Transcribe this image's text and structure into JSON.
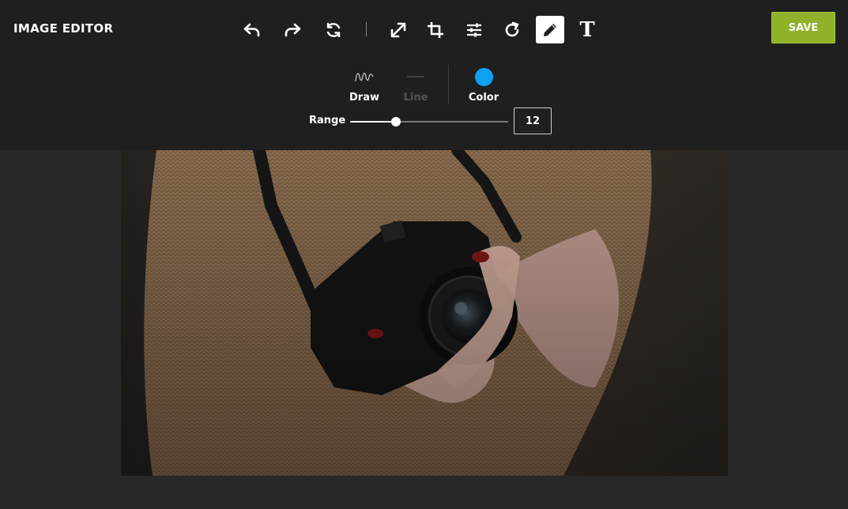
{
  "app": {
    "title": "IMAGE EDITOR"
  },
  "toolbar": {
    "tools": [
      {
        "name": "undo",
        "icon": "undo-icon"
      },
      {
        "name": "redo",
        "icon": "redo-icon"
      },
      {
        "name": "reset",
        "icon": "reset-icon"
      },
      {
        "name": "resize",
        "icon": "resize-icon"
      },
      {
        "name": "crop",
        "icon": "crop-icon"
      },
      {
        "name": "adjust",
        "icon": "sliders-icon"
      },
      {
        "name": "rotate",
        "icon": "rotate-icon"
      },
      {
        "name": "draw",
        "icon": "pencil-icon",
        "active": true
      },
      {
        "name": "text",
        "icon": "text-icon",
        "glyph": "T"
      }
    ],
    "save_label": "SAVE"
  },
  "draw_panel": {
    "draw_label": "Draw",
    "line_label": "Line",
    "color_label": "Color",
    "color_value": "#0ea1f2",
    "range_label": "Range",
    "range_value": "12",
    "range_fraction": 0.29
  },
  "canvas": {
    "image_subject": "person-holding-camera-photo"
  },
  "colors": {
    "accent": "#8fb22a",
    "brush": "#0ea1f2",
    "toolbar_bg": "#1f1f1f",
    "workspace_bg": "#282828"
  }
}
